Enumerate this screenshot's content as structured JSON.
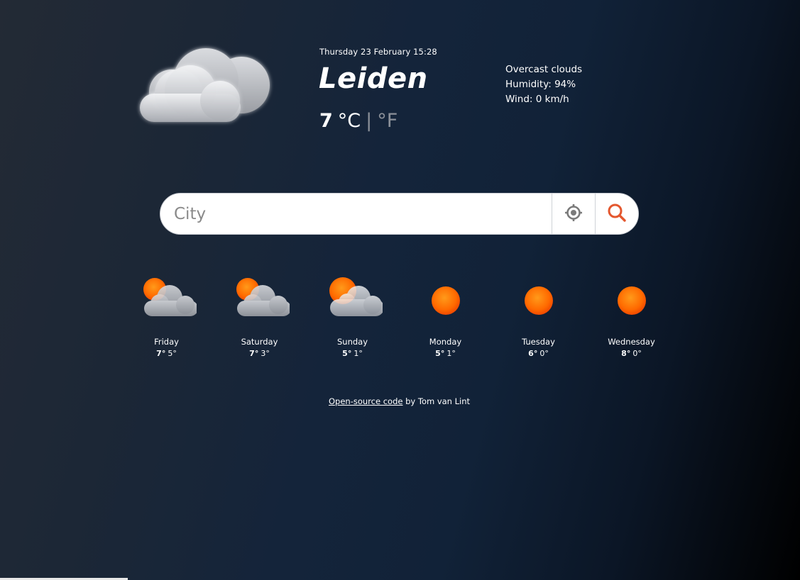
{
  "header": {
    "date": "Thursday 23 February 15:28",
    "city": "Leiden",
    "temperature": "7",
    "unit_celsius": "°C",
    "unit_separator": "|",
    "unit_fahrenheit": "°F",
    "current_icon": "cloud-icon"
  },
  "details": {
    "description": "Overcast clouds",
    "humidity": "Humidity: 94%",
    "wind": "Wind: 0 km/h"
  },
  "search": {
    "placeholder": "City",
    "location_icon": "crosshair-icon",
    "search_icon": "search-icon"
  },
  "forecast": [
    {
      "day": "Friday",
      "high": "7°",
      "low": "5°",
      "icon": "sun-rain-cloud-icon"
    },
    {
      "day": "Saturday",
      "high": "7°",
      "low": "3°",
      "icon": "sun-rain-cloud-icon"
    },
    {
      "day": "Sunday",
      "high": "5°",
      "low": "1°",
      "icon": "sun-cloud-icon"
    },
    {
      "day": "Monday",
      "high": "5°",
      "low": "1°",
      "icon": "sun-icon"
    },
    {
      "day": "Tuesday",
      "high": "6°",
      "low": "0°",
      "icon": "sun-icon"
    },
    {
      "day": "Wednesday",
      "high": "8°",
      "low": "0°",
      "icon": "sun-icon"
    }
  ],
  "footer": {
    "link_text": "Open-source code",
    "author_text": " by Tom van Lint"
  },
  "colors": {
    "sun": "#ff7a00",
    "rain": "#5fe0e0",
    "search_accent": "#e4572e"
  }
}
